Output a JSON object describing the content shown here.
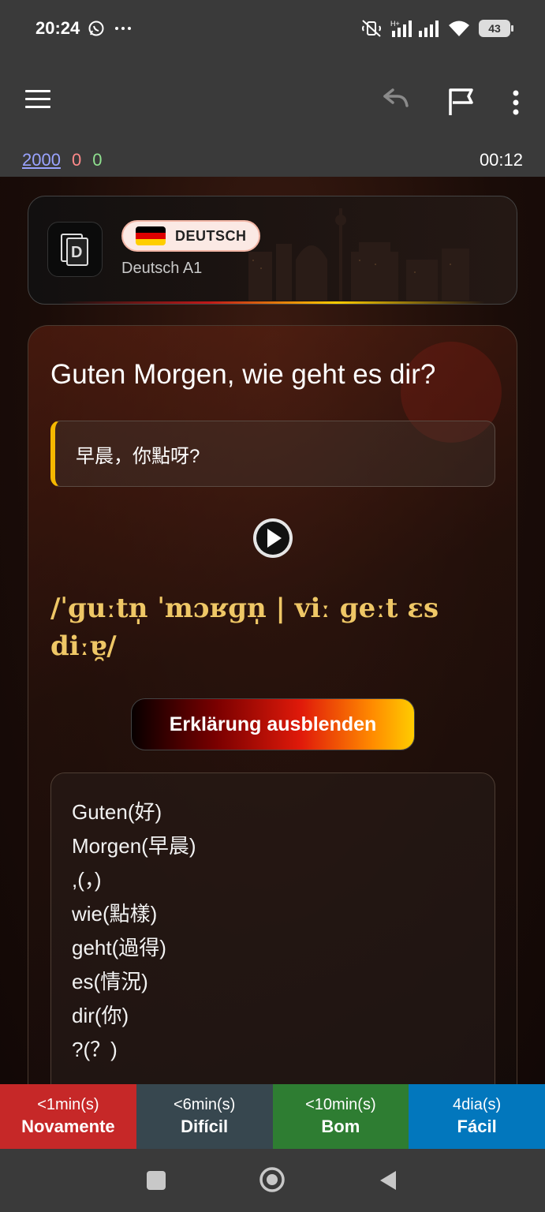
{
  "status_bar": {
    "time": "20:24",
    "battery": "43",
    "icons": [
      "whatsapp-icon",
      "more-dots-icon",
      "mute-icon",
      "signal-icon",
      "wifi-icon",
      "battery-icon"
    ]
  },
  "toolbar": {
    "icons": [
      "menu-icon",
      "undo-icon",
      "flag-icon",
      "more-vert-icon"
    ]
  },
  "counters": {
    "new": "2000",
    "learning": "0",
    "review": "0",
    "timer": "00:12",
    "colors": {
      "new": "#9aa3ff",
      "learning": "#ff8a8a",
      "review": "#8fe08f"
    }
  },
  "deck_header": {
    "language_label": "DEUTSCH",
    "deck_name": "Deutsch A1"
  },
  "card": {
    "front": "Guten Morgen, wie geht es dir?",
    "translation": "早晨，你點呀?",
    "ipa": "/ˈɡuːtn̩ ˈmɔʁɡn̩ | viː ɡeːt ɛs diːɐ̯/",
    "explain_button": "Erklärung ausblenden",
    "explanation_lines": [
      "Guten(好)",
      "Morgen(早晨)",
      ",(，)",
      "wie(點樣)",
      "geht(過得)",
      "es(情況)",
      "dir(你)",
      "?(？)"
    ]
  },
  "answers": [
    {
      "time": "<1min(s)",
      "label": "Novamente",
      "color": "#c62828"
    },
    {
      "time": "<6min(s)",
      "label": "Difícil",
      "color": "#37474f"
    },
    {
      "time": "<10min(s)",
      "label": "Bom",
      "color": "#2e7d32"
    },
    {
      "time": "4dia(s)",
      "label": "Fácil",
      "color": "#0277bd"
    }
  ],
  "colors": {
    "ipa": "#efc766",
    "accent_bar": "#f5b800"
  }
}
